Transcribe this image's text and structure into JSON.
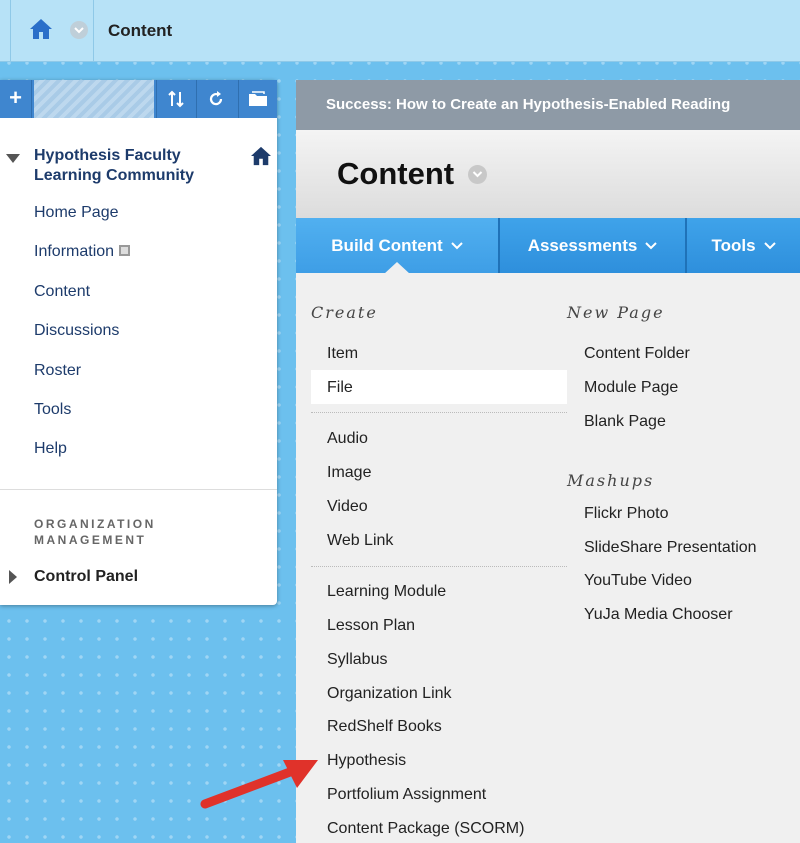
{
  "topbar": {
    "breadcrumb": "Content"
  },
  "left_menu": {
    "course_title": "Hypothesis Faculty Learning Community",
    "items": [
      {
        "label": "Home Page"
      },
      {
        "label": "Information"
      },
      {
        "label": "Content"
      },
      {
        "label": "Discussions"
      },
      {
        "label": "Roster"
      },
      {
        "label": "Tools"
      },
      {
        "label": "Help"
      }
    ],
    "management_label": "ORGANIZATION MANAGEMENT",
    "control_panel": "Control Panel"
  },
  "content": {
    "success_message": "Success: How to Create an Hypothesis-Enabled Reading",
    "page_title": "Content",
    "actions": [
      {
        "label": "Build Content"
      },
      {
        "label": "Assessments"
      },
      {
        "label": "Tools"
      }
    ]
  },
  "build_menu": {
    "create_heading": "Create",
    "create_items": [
      "Item",
      "File"
    ],
    "media_items": [
      "Audio",
      "Image",
      "Video",
      "Web Link"
    ],
    "other_items": [
      "Learning Module",
      "Lesson Plan",
      "Syllabus",
      "Organization Link",
      "RedShelf Books",
      "Hypothesis",
      "Portfolium Assignment",
      "Content Package (SCORM)"
    ],
    "new_page_heading": "New Page",
    "new_page_items": [
      "Content Folder",
      "Module Page",
      "Blank Page"
    ],
    "mashups_heading": "Mashups",
    "mashups_items": [
      "Flickr Photo",
      "SlideShare Presentation",
      "YouTube Video",
      "YuJa Media Chooser"
    ]
  },
  "colors": {
    "accent": "#2e8fdc",
    "annotation_arrow": "#e0322a",
    "nav_text": "#1d3b6b"
  }
}
